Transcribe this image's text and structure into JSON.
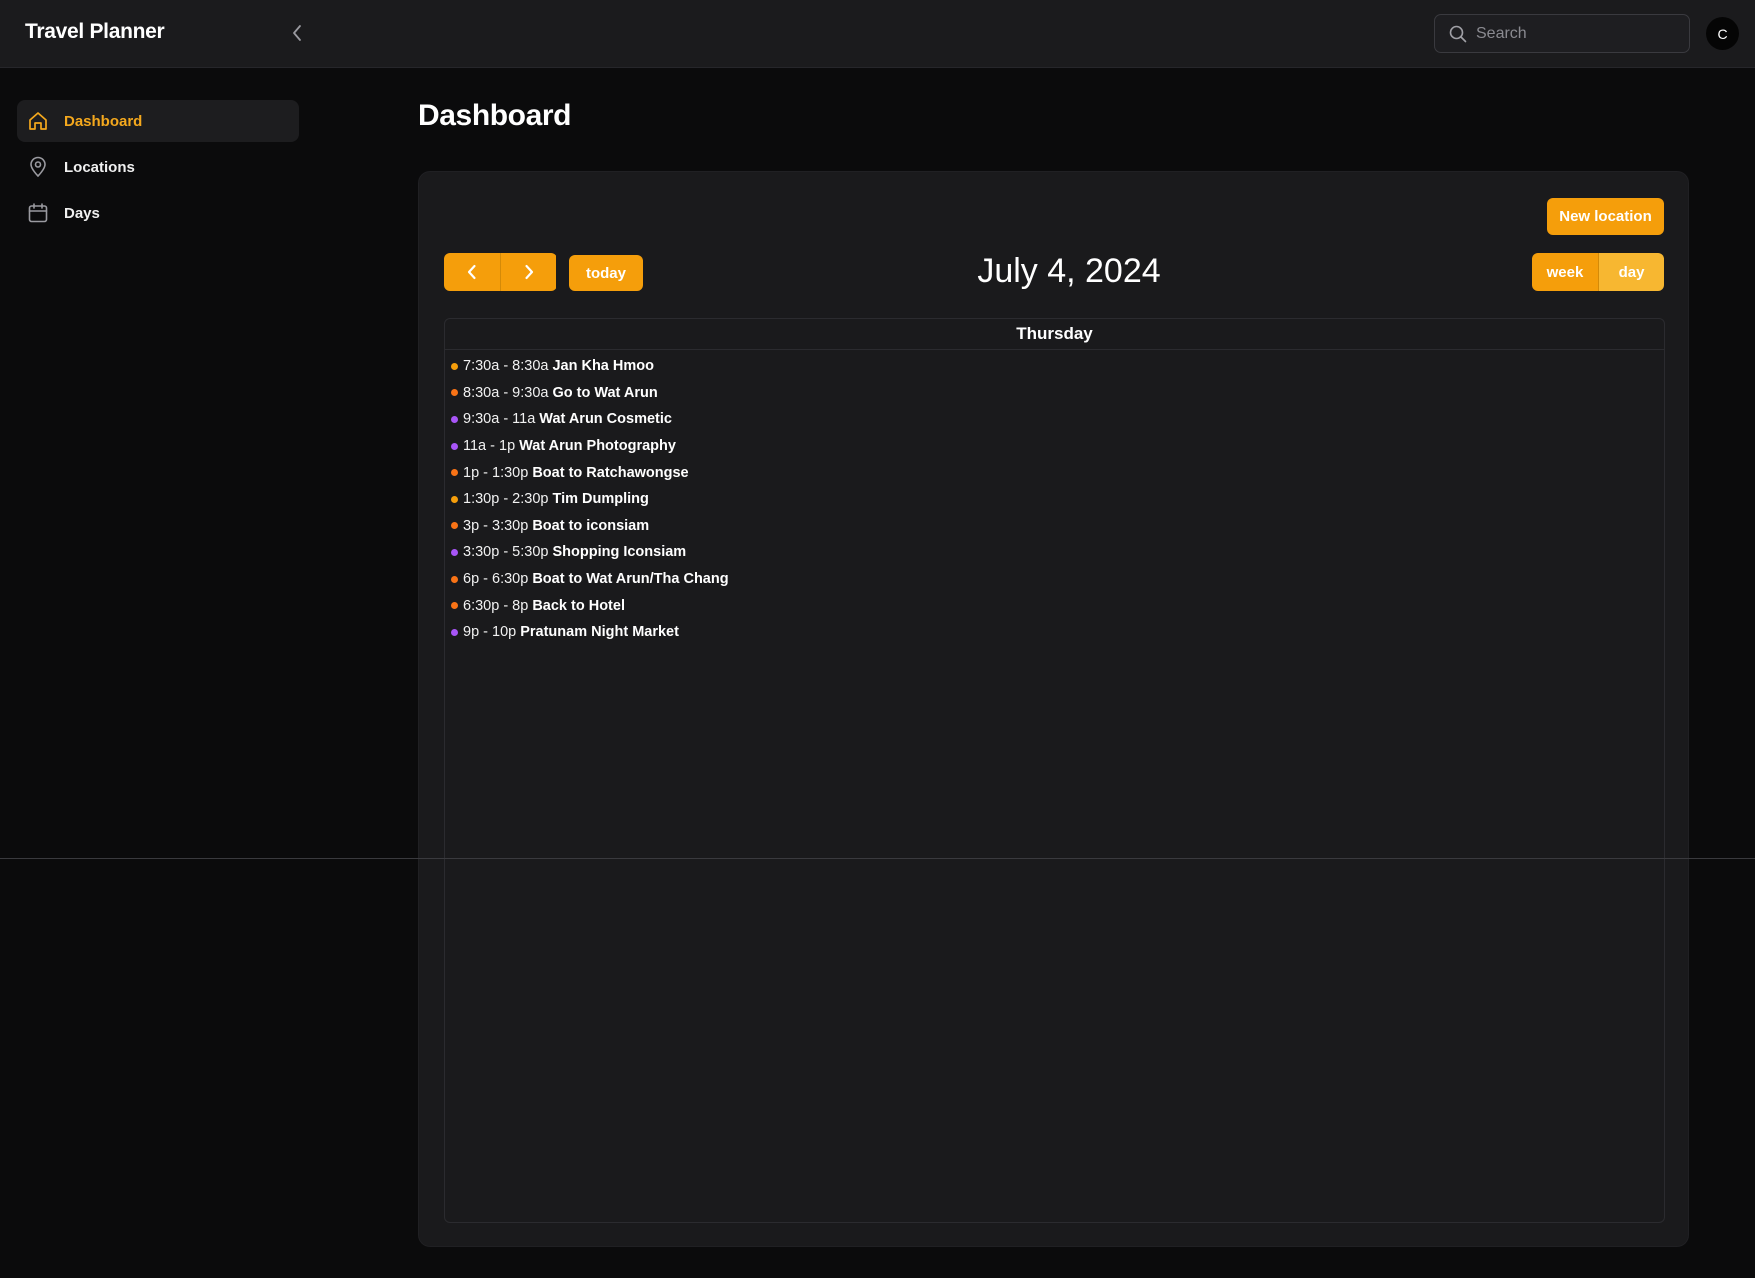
{
  "header": {
    "app_title": "Travel Planner",
    "search": {
      "placeholder": "Search",
      "value": ""
    },
    "avatar_initial": "C"
  },
  "sidebar": {
    "items": [
      {
        "label": "Dashboard",
        "icon": "home-icon",
        "active": true
      },
      {
        "label": "Locations",
        "icon": "map-pin-icon",
        "active": false
      },
      {
        "label": "Days",
        "icon": "calendar-icon",
        "active": false
      }
    ]
  },
  "main": {
    "page_title": "Dashboard",
    "new_location_label": "New location",
    "today_label": "today",
    "date_title": "July 4, 2024",
    "views": {
      "week_label": "week",
      "day_label": "day",
      "selected": "day"
    },
    "day_header": "Thursday",
    "events": [
      {
        "time": "7:30a - 8:30a",
        "title": "Jan Kha Hmoo",
        "color": "#f59e0b"
      },
      {
        "time": "8:30a - 9:30a",
        "title": "Go to Wat Arun",
        "color": "#f97316"
      },
      {
        "time": "9:30a - 11a",
        "title": "Wat Arun Cosmetic",
        "color": "#a855f7"
      },
      {
        "time": "11a - 1p",
        "title": "Wat Arun Photography",
        "color": "#a855f7"
      },
      {
        "time": "1p - 1:30p",
        "title": "Boat to Ratchawongse",
        "color": "#f97316"
      },
      {
        "time": "1:30p - 2:30p",
        "title": "Tim Dumpling",
        "color": "#f59e0b"
      },
      {
        "time": "3p - 3:30p",
        "title": "Boat to iconsiam",
        "color": "#f97316"
      },
      {
        "time": "3:30p - 5:30p",
        "title": "Shopping Iconsiam",
        "color": "#a855f7"
      },
      {
        "time": "6p - 6:30p",
        "title": "Boat to Wat Arun/Tha Chang",
        "color": "#f97316"
      },
      {
        "time": "6:30p - 8p",
        "title": "Back to Hotel",
        "color": "#f97316"
      },
      {
        "time": "9p - 10p",
        "title": "Pratunam Night Market",
        "color": "#a855f7"
      }
    ]
  },
  "colors": {
    "accent": "#f59e0b",
    "accent_active": "#f7b731",
    "background": "#0b0b0c",
    "surface": "#1a1a1c"
  }
}
